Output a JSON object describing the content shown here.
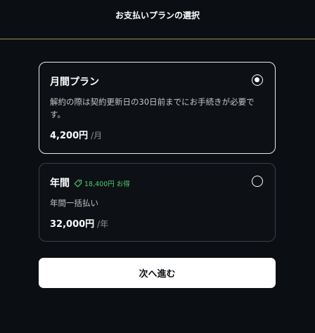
{
  "header": {
    "title": "お支払いプランの選択"
  },
  "plans": [
    {
      "title": "月間プラン",
      "description": "解約の際は契約更新日の30日前までにお手続きが必要です。",
      "price": "4,200円",
      "unit": "/月",
      "selected": true
    },
    {
      "title": "年間",
      "badge": "18,400円 お得",
      "badge_icon": "tag-icon",
      "description": "年間一括払い",
      "price": "32,000円",
      "unit": "/年",
      "selected": false
    }
  ],
  "actions": {
    "next_label": "次へ進む"
  },
  "colors": {
    "background": "#0b0f13",
    "accent_divider": "#a08f53",
    "badge_green": "#4ecb71",
    "button_bg": "#ffffff"
  }
}
